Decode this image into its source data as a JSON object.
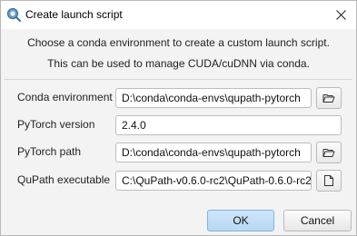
{
  "window": {
    "title": "Create launch script"
  },
  "description": {
    "line1": "Choose a conda environment to create a custom launch script.",
    "line2": "This can be used to manage CUDA/cuDNN via conda."
  },
  "form": {
    "conda_env": {
      "label": "Conda environment",
      "value": "D:\\conda\\conda-envs\\qupath-pytorch"
    },
    "pytorch_version": {
      "label": "PyTorch version",
      "value": "2.4.0"
    },
    "pytorch_path": {
      "label": "PyTorch path",
      "value": "D:\\conda\\conda-envs\\qupath-pytorch"
    },
    "qupath_exe": {
      "label": "QuPath executable",
      "value": "C:\\QuPath-v0.6.0-rc2\\QuPath-0.6.0-rc2"
    }
  },
  "buttons": {
    "ok": "OK",
    "cancel": "Cancel"
  },
  "icons": {
    "app": "qupath-icon",
    "close": "close-icon",
    "folder": "folder-open-icon",
    "file": "file-icon"
  },
  "colors": {
    "ok_button": "#c3dff6",
    "ok_border": "#7fb3e6"
  }
}
